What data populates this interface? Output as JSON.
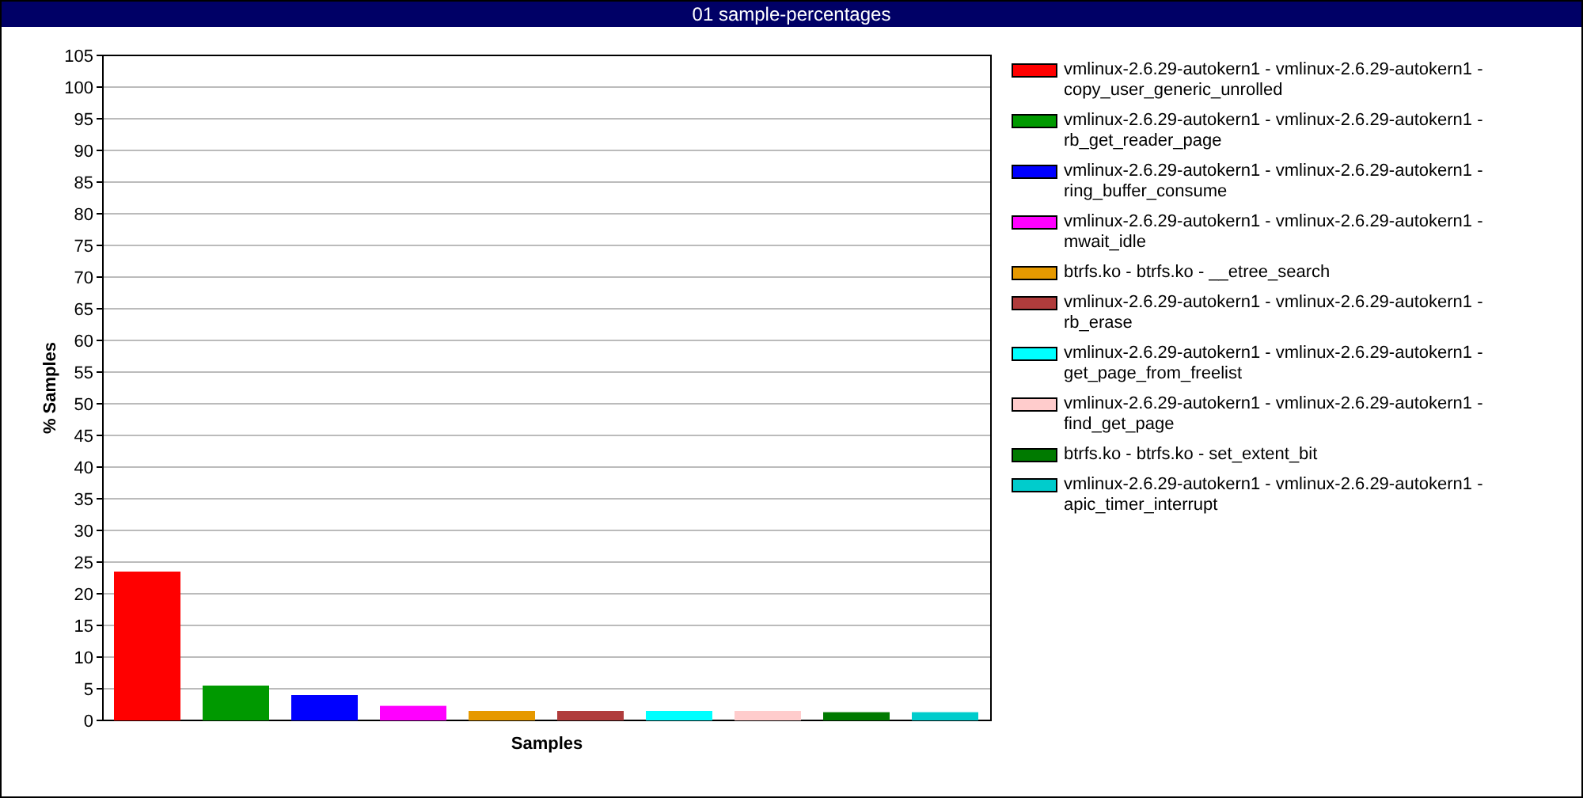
{
  "window": {
    "title": "01 sample-percentages"
  },
  "chart": {
    "chart_data": {
      "type": "bar",
      "xlabel": "Samples",
      "ylabel": "% Samples",
      "grid": true,
      "ylim": [
        0,
        105
      ],
      "yticks": [
        0,
        5,
        10,
        15,
        20,
        25,
        30,
        35,
        40,
        45,
        50,
        55,
        60,
        65,
        70,
        75,
        80,
        85,
        90,
        95,
        100,
        105
      ],
      "series": [
        {
          "name": "vmlinux-2.6.29-autokern1 - vmlinux-2.6.29-autokern1 - copy_user_generic_unrolled",
          "color": "#ff0000",
          "values": [
            23.5
          ]
        },
        {
          "name": "vmlinux-2.6.29-autokern1 - vmlinux-2.6.29-autokern1 - rb_get_reader_page",
          "color": "#009900",
          "values": [
            5.5
          ]
        },
        {
          "name": "vmlinux-2.6.29-autokern1 - vmlinux-2.6.29-autokern1 - ring_buffer_consume",
          "color": "#0000ff",
          "values": [
            4.0
          ]
        },
        {
          "name": "vmlinux-2.6.29-autokern1 - vmlinux-2.6.29-autokern1 - mwait_idle",
          "color": "#ff00ff",
          "values": [
            2.3
          ]
        },
        {
          "name": "btrfs.ko - btrfs.ko - __etree_search",
          "color": "#e69900",
          "values": [
            1.5
          ]
        },
        {
          "name": "vmlinux-2.6.29-autokern1 - vmlinux-2.6.29-autokern1 - rb_erase",
          "color": "#b03c3c",
          "values": [
            1.5
          ]
        },
        {
          "name": "vmlinux-2.6.29-autokern1 - vmlinux-2.6.29-autokern1 - get_page_from_freelist",
          "color": "#00ffff",
          "values": [
            1.5
          ]
        },
        {
          "name": "vmlinux-2.6.29-autokern1 - vmlinux-2.6.29-autokern1 - find_get_page",
          "color": "#ffcccc",
          "values": [
            1.5
          ]
        },
        {
          "name": "btrfs.ko - btrfs.ko - set_extent_bit",
          "color": "#007a00",
          "values": [
            1.3
          ]
        },
        {
          "name": "vmlinux-2.6.29-autokern1 - vmlinux-2.6.29-autokern1 - apic_timer_interrupt",
          "color": "#00cccc",
          "values": [
            1.3
          ]
        }
      ]
    }
  }
}
